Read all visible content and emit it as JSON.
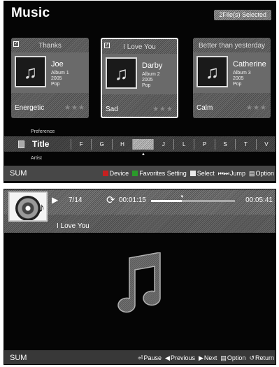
{
  "browser": {
    "title": "Music",
    "selected_badge": "2File(s) Selected",
    "cards": [
      {
        "title": "Thanks",
        "checked": true,
        "artist": "Joe",
        "meta": [
          "Album 1",
          "2005",
          "Pop"
        ],
        "mood": "Energetic",
        "stars": "★★★",
        "selected": false
      },
      {
        "title": "I Love You",
        "checked": true,
        "artist": "Darby",
        "meta": [
          "Album 2",
          "2005",
          "Pop"
        ],
        "mood": "Sad",
        "stars": "★★★",
        "selected": true
      },
      {
        "title": "Better than yesterday",
        "checked": false,
        "artist": "Catherine",
        "meta": [
          "Album 3",
          "2005",
          "Pop"
        ],
        "mood": "Calm",
        "stars": "★★★",
        "selected": false
      }
    ],
    "sort": {
      "above_label": "Preference",
      "label": "Title",
      "below_label": "Artist",
      "letters": [
        "F",
        "G",
        "H",
        "",
        "J",
        "L",
        "P",
        "S",
        "T",
        "V"
      ],
      "current_index": 3
    },
    "footer": {
      "sum": "SUM",
      "keys": [
        {
          "icon": "red-square",
          "color": "#c62020",
          "label": "Device"
        },
        {
          "icon": "green-square",
          "color": "#2a9a2a",
          "label": "Favorites Setting"
        },
        {
          "icon": "yellow-square",
          "color": "#e8e8e8",
          "label": "Select"
        },
        {
          "icon": "skip-buttons-icon",
          "glyph": "⏮⏭",
          "label": "Jump"
        },
        {
          "icon": "tools-icon",
          "glyph": "▤",
          "label": "Option"
        }
      ]
    }
  },
  "player": {
    "track_position": "7/14",
    "elapsed": "00:01:15",
    "total": "00:05:41",
    "progress_fraction": 0.37,
    "song_title": "I Love You",
    "footer": {
      "sum": "SUM",
      "keys": [
        {
          "icon": "pause-icon",
          "glyph": "⏎",
          "label": "Pause"
        },
        {
          "icon": "previous-icon",
          "glyph": "◀",
          "label": "Previous"
        },
        {
          "icon": "next-icon",
          "glyph": "▶",
          "label": "Next"
        },
        {
          "icon": "tools-icon",
          "glyph": "▤",
          "label": "Option"
        },
        {
          "icon": "return-icon",
          "glyph": "↺",
          "label": "Return"
        }
      ]
    }
  }
}
